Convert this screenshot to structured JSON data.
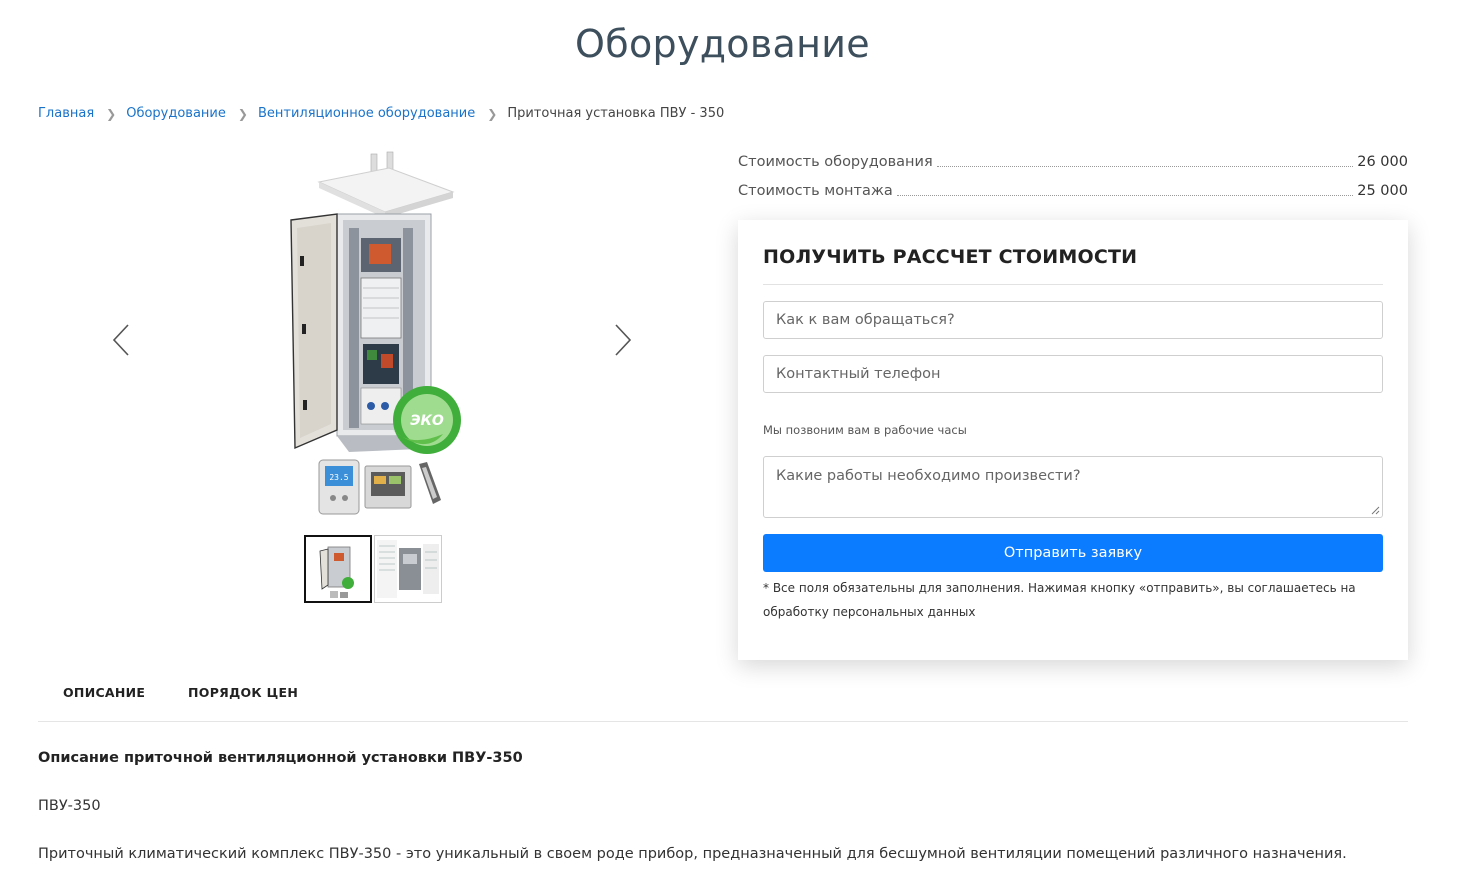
{
  "page": {
    "title": "Оборудование"
  },
  "breadcrumb": {
    "items": [
      "Главная",
      "Оборудование",
      "Вентиляционное оборудование"
    ],
    "current": "Приточная установка ПВУ - 350"
  },
  "gallery": {
    "badge_text": "ЭКО",
    "controller_display": "23.5",
    "thumbnail_count": 2,
    "active_thumbnail": 1
  },
  "prices": [
    {
      "label": "Стоимость оборудования",
      "value": "26 000"
    },
    {
      "label": "Стоимость монтажа",
      "value": "25 000"
    }
  ],
  "form": {
    "title": "ПОЛУЧИТЬ РАССЧЕТ СТОИМОСТИ",
    "name_placeholder": "Как к вам обращаться?",
    "phone_placeholder": "Контактный телефон",
    "hint": "Мы позвоним вам в рабочие часы",
    "works_placeholder": "Какие работы необходимо произвести?",
    "submit_label": "Отправить заявку",
    "note": "* Все поля обязательны для заполнения. Нажимая кнопку «отправить», вы соглашаетесь на обработку персональных данных"
  },
  "tabs": [
    "ОПИСАНИЕ",
    "ПОРЯДОК ЦЕН"
  ],
  "description": {
    "title": "Описание приточной вентиляционной установки ПВУ-350",
    "p1": "ПВУ-350",
    "p2": "Приточный климатический комплекс ПВУ-350 - это уникальный в своем роде прибор, предназначенный для бесшумной вентиляции помещений различного назначения."
  },
  "colors": {
    "link": "#1a73c9",
    "title": "#3d4f5c",
    "button": "#0b7cff",
    "badge": "#3fae3a"
  }
}
